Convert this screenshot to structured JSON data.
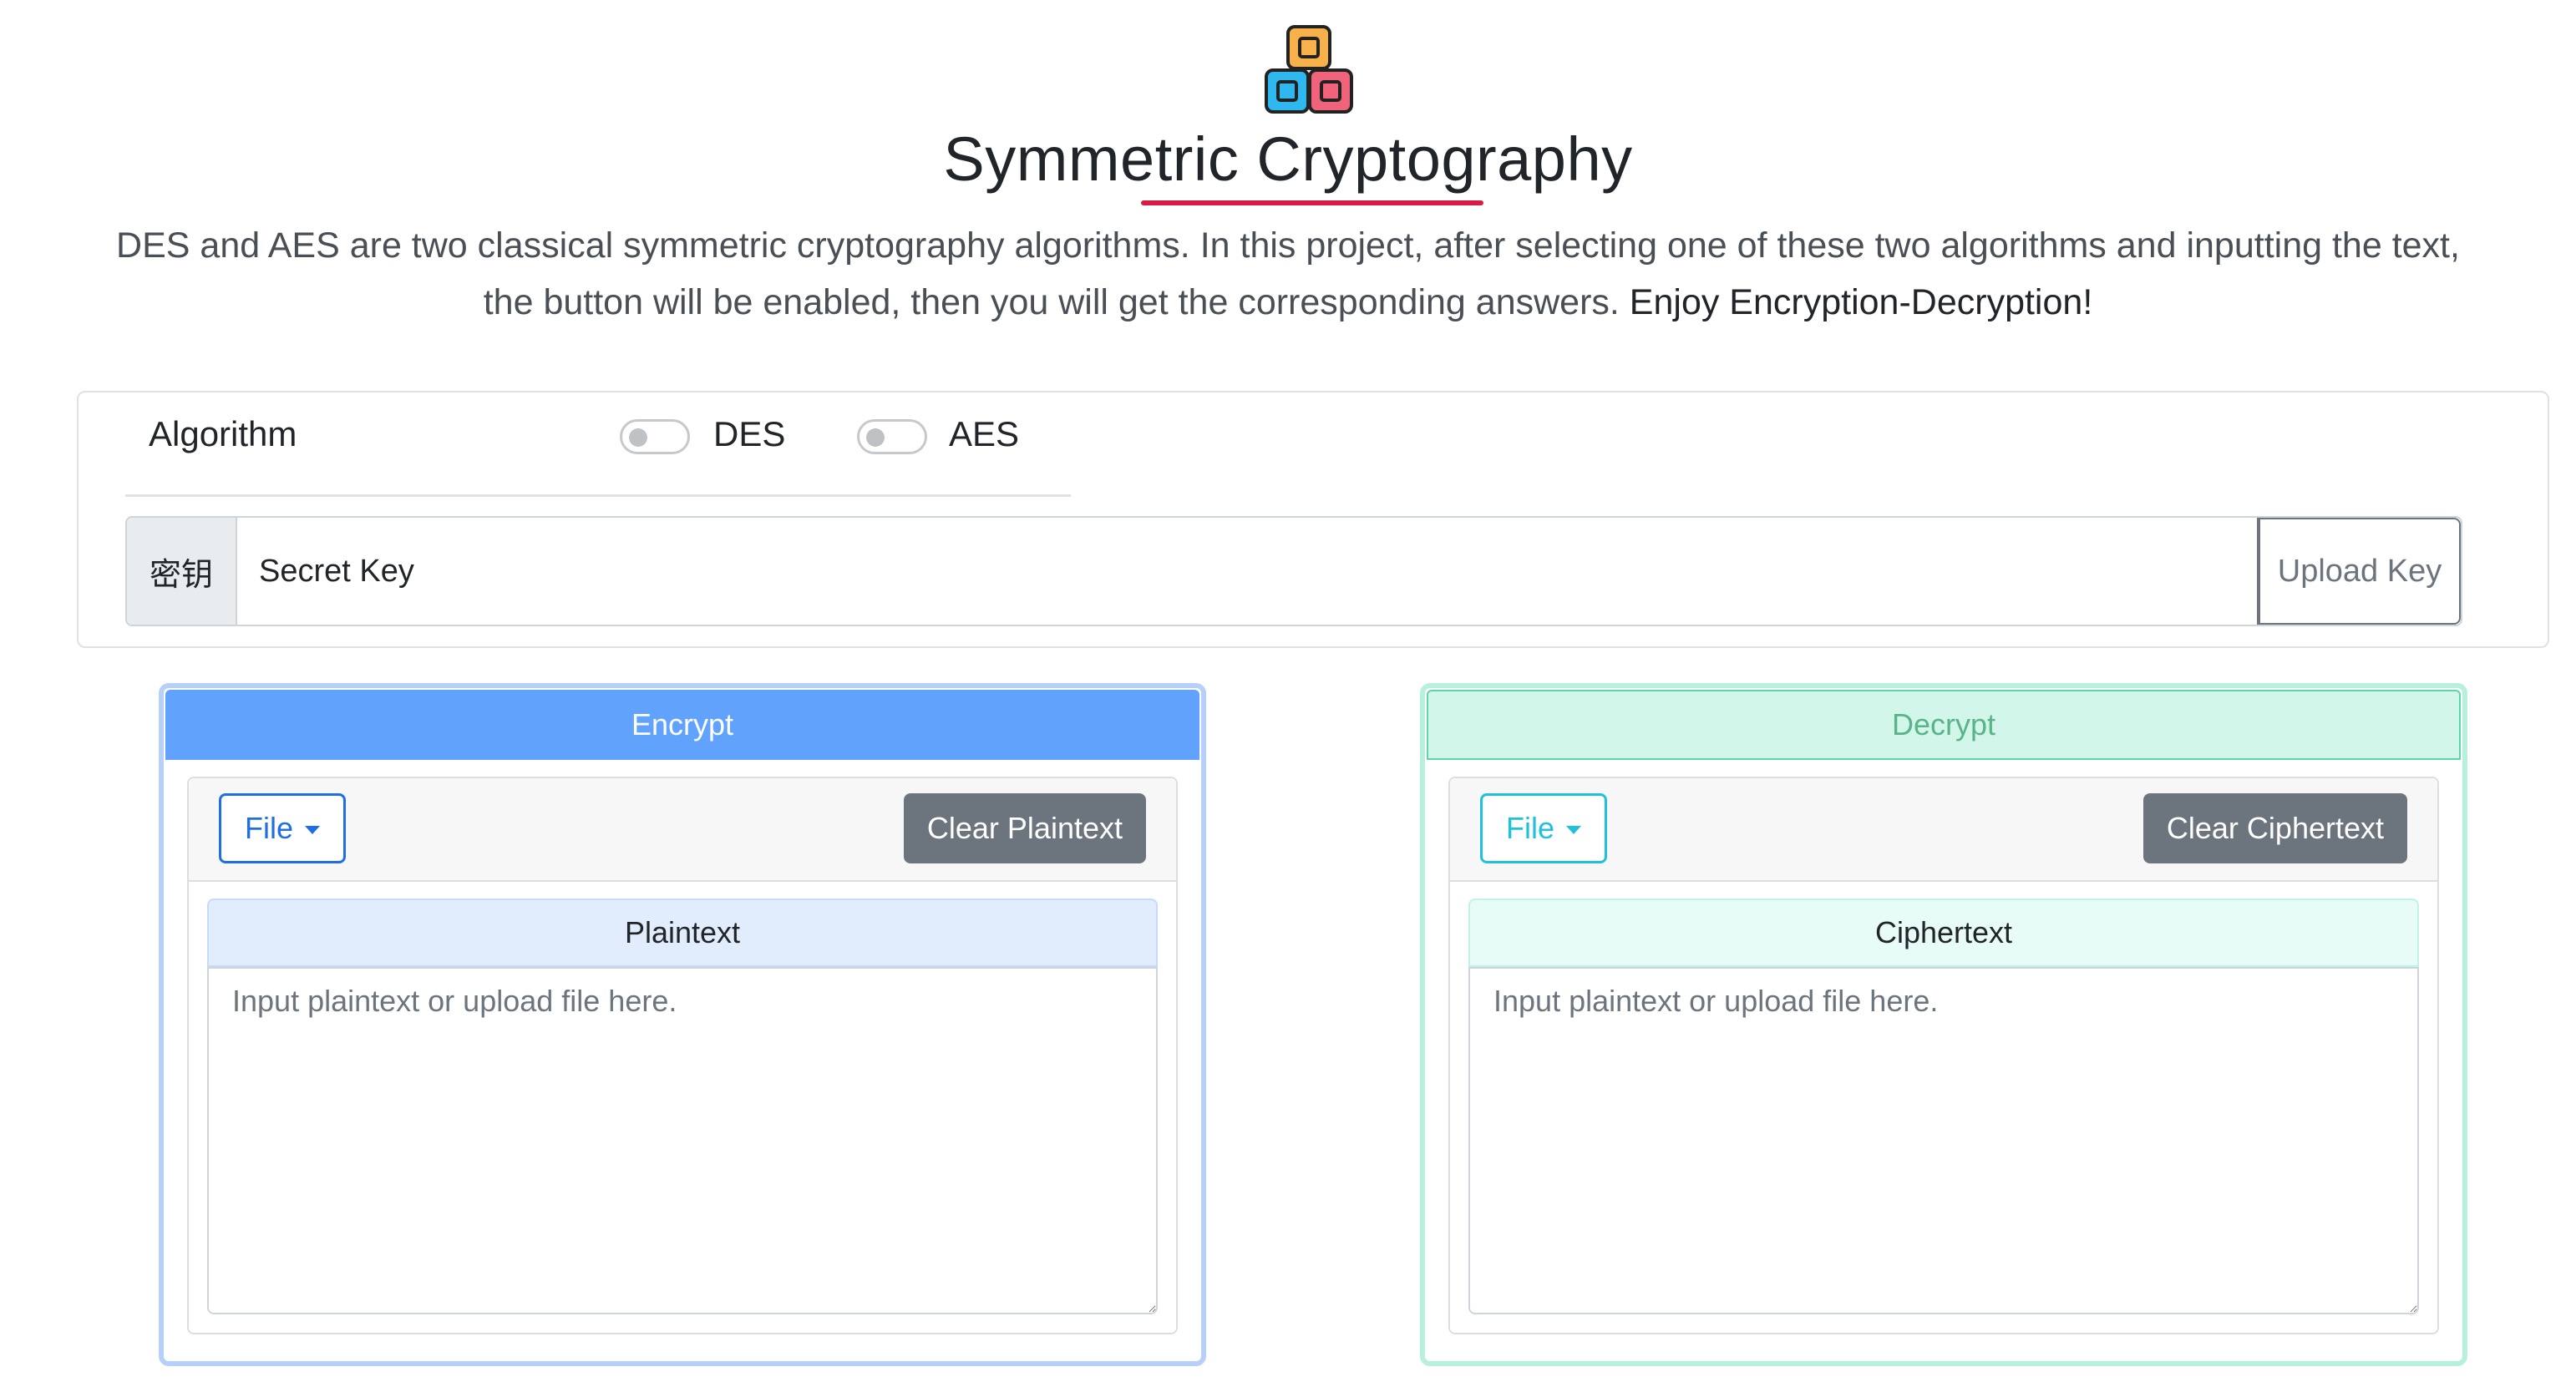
{
  "header": {
    "logo_icon": "stacked-blocks-icon",
    "title": "Symmetric Cryptography",
    "intro_text": "DES and AES are two classical symmetric cryptography algorithms. In this project, after selecting one of these two algorithms and inputting the text, the button will be enabled, then you will get the corresponding answers. ",
    "intro_strong": "Enjoy Encryption-Decryption!",
    "accent_color": "#d81b45"
  },
  "algorithm": {
    "label": "Algorithm",
    "options": [
      {
        "label": "DES",
        "checked": false
      },
      {
        "label": "AES",
        "checked": false
      }
    ]
  },
  "key": {
    "prefix": "密钥",
    "placeholder": "Secret Key",
    "upload_label": "Upload Key"
  },
  "encrypt": {
    "header": "Encrypt",
    "file_label": "File",
    "clear_label": "Clear Plaintext",
    "field_label": "Plaintext",
    "placeholder": "Input plaintext or upload file here.",
    "color": "#61a2fd"
  },
  "decrypt": {
    "header": "Decrypt",
    "file_label": "File",
    "clear_label": "Clear Ciphertext",
    "field_label": "Ciphertext",
    "placeholder": "Input plaintext or upload file here.",
    "color": "#d3f6ea"
  }
}
